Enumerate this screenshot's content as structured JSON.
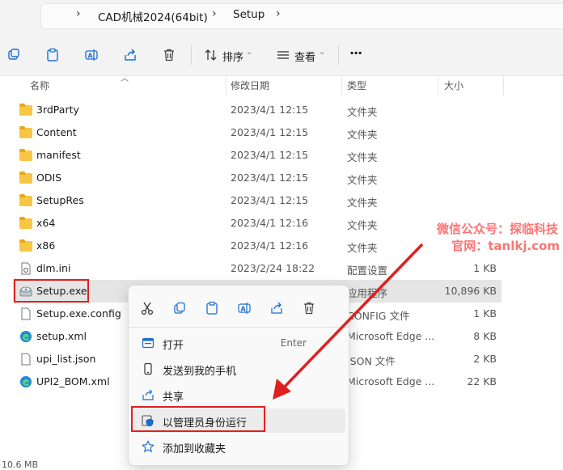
{
  "address": {
    "crumbs": [
      "CAD机械2024(64bit)",
      "Setup"
    ]
  },
  "toolbar": {
    "sort_label": "排序",
    "view_label": "查看",
    "more_label": "···"
  },
  "columns": {
    "name": "名称",
    "date": "修改日期",
    "type": "类型",
    "size": "大小"
  },
  "files": [
    {
      "name": "3rdParty",
      "date": "2023/4/1 12:15",
      "type": "文件夹",
      "size": "",
      "icon": "folder-icon"
    },
    {
      "name": "Content",
      "date": "2023/4/1 12:15",
      "type": "文件夹",
      "size": "",
      "icon": "folder-icon"
    },
    {
      "name": "manifest",
      "date": "2023/4/1 12:15",
      "type": "文件夹",
      "size": "",
      "icon": "folder-icon"
    },
    {
      "name": "ODIS",
      "date": "2023/4/1 12:15",
      "type": "文件夹",
      "size": "",
      "icon": "folder-icon"
    },
    {
      "name": "SetupRes",
      "date": "2023/4/1 12:15",
      "type": "文件夹",
      "size": "",
      "icon": "folder-icon"
    },
    {
      "name": "x64",
      "date": "2023/4/1 12:16",
      "type": "文件夹",
      "size": "",
      "icon": "folder-icon"
    },
    {
      "name": "x86",
      "date": "2023/4/1 12:16",
      "type": "文件夹",
      "size": "",
      "icon": "folder-icon"
    },
    {
      "name": "dlm.ini",
      "date": "2023/2/24 18:22",
      "type": "配置设置",
      "size": "1 KB",
      "icon": "ini-file-icon"
    },
    {
      "name": "Setup.exe",
      "date": "",
      "type": "应用程序",
      "size": "10,896 KB",
      "icon": "setup-exe-icon"
    },
    {
      "name": "Setup.exe.config",
      "date": "",
      "type": "CONFIG 文件",
      "size": "1 KB",
      "icon": "config-file-icon"
    },
    {
      "name": "setup.xml",
      "date": "",
      "type": "Microsoft Edge ...",
      "size": "8 KB",
      "icon": "edge-icon"
    },
    {
      "name": "upi_list.json",
      "date": "",
      "type": "JSON 文件",
      "size": "2 KB",
      "icon": "json-file-icon"
    },
    {
      "name": "UPI2_BOM.xml",
      "date": "",
      "type": "Microsoft Edge ...",
      "size": "22 KB",
      "icon": "edge-icon"
    }
  ],
  "context_menu": {
    "icons": [
      "cut-icon",
      "copy-icon",
      "paste-icon",
      "rename-icon",
      "share-icon",
      "delete-icon"
    ],
    "items": [
      {
        "label": "打开",
        "shortcut": "Enter",
        "icon": "open-icon"
      },
      {
        "label": "发送到我的手机",
        "shortcut": "",
        "icon": "phone-icon"
      },
      {
        "label": "共享",
        "shortcut": "",
        "icon": "share-icon"
      },
      {
        "label": "以管理员身份运行",
        "shortcut": "",
        "icon": "admin-shield-icon"
      },
      {
        "label": "添加到收藏夹",
        "shortcut": "",
        "icon": "star-icon"
      }
    ]
  },
  "status": {
    "size_text": "10.6 MB"
  },
  "watermark": {
    "line1": "微信公众号：探临科技",
    "line2": "官网：tanlkj.com"
  },
  "colors": {
    "annotation_red": "#e02020",
    "folder_yellow": "#f7c645",
    "accent_blue": "#1a6fd1"
  }
}
